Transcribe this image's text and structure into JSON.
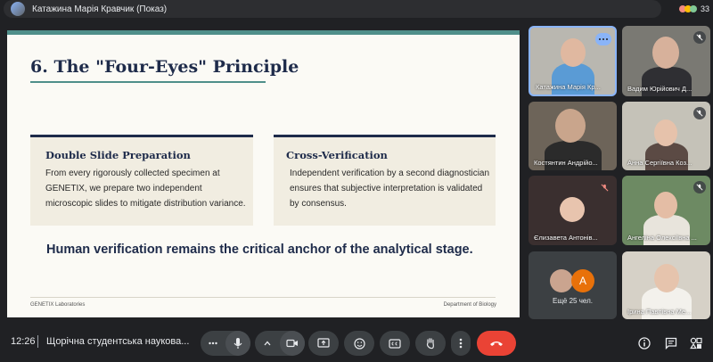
{
  "window": {
    "presenter_label": "Катажина Марія Кравчик (Показ)",
    "participant_count": "33"
  },
  "slide": {
    "title": "6. The \"Four-Eyes\" Principle",
    "cards": [
      {
        "heading": "Double Slide Preparation",
        "body": "From every rigorously collected specimen at GENETIX, we prepare two independent microscopic slides to mitigate distribution variance."
      },
      {
        "heading": "Cross-Verification",
        "body": "Independent verification by a second diagnostician ensures that subjective interpretation is validated by consensus."
      }
    ],
    "statement": "Human verification remains the critical anchor of the analytical stage.",
    "footer_left": "GENETIX Laboratories",
    "footer_right": "Department of Biology"
  },
  "participants": [
    {
      "name": "Катажина Марія Кр..."
    },
    {
      "name": "Вадим Юрійович Д..."
    },
    {
      "name": "Костянтин Андрійо..."
    },
    {
      "name": "Анна Сергіївна Коз..."
    },
    {
      "name": "Єлизавета Антонів..."
    },
    {
      "name": "Ангеліна Олексіївна ..."
    },
    {
      "name": "Ещё 25 чел."
    },
    {
      "name": "Ірина Павлівна Ме..."
    }
  ],
  "more_avatar_letter": "А",
  "bottom": {
    "time": "12:26",
    "meeting_title": "Щорічна студентська наукова..."
  },
  "colors": {
    "accent": "#8ab4f8",
    "end_call": "#ea4335",
    "slide_navy": "#1e2b4a",
    "slide_teal": "#4f8f8a"
  }
}
